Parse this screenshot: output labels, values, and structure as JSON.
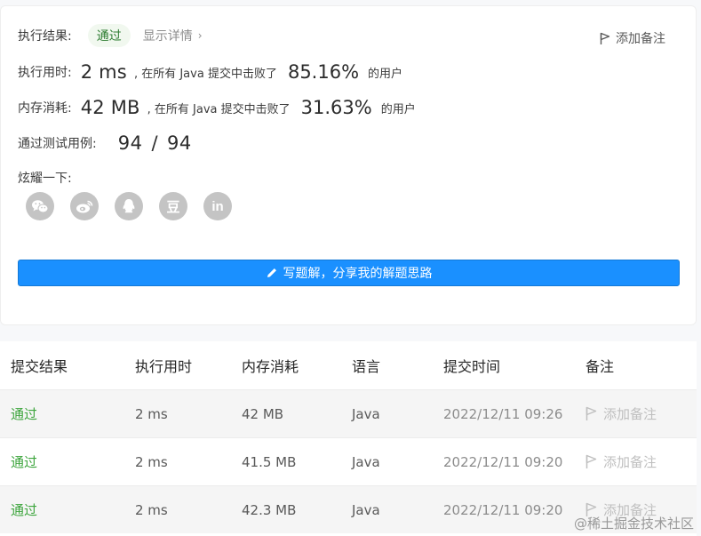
{
  "result": {
    "label": "执行结果:",
    "status": "通过",
    "detail_link": "显示详情",
    "add_note": "添加备注"
  },
  "runtime": {
    "label": "执行用时:",
    "value": "2 ms",
    "mid_text": ", 在所有 Java 提交中击败了",
    "percent": "85.16%",
    "suffix": "的用户"
  },
  "memory": {
    "label": "内存消耗:",
    "value": "42 MB",
    "mid_text": ", 在所有 Java 提交中击败了",
    "percent": "31.63%",
    "suffix": "的用户"
  },
  "testcases": {
    "label": "通过测试用例:",
    "passed": "94",
    "sep": "/",
    "total": "94"
  },
  "share": {
    "label": "炫耀一下:",
    "icons": [
      "wechat-icon",
      "weibo-icon",
      "qq-icon",
      "douban-icon",
      "linkedin-icon"
    ],
    "douban_text": "豆",
    "linkedin_text": "in"
  },
  "write_solution_label": "写题解，分享我的解题思路",
  "table": {
    "headers": [
      "提交结果",
      "执行用时",
      "内存消耗",
      "语言",
      "提交时间",
      "备注"
    ],
    "rows": [
      {
        "result": "通过",
        "time": "2 ms",
        "memory": "42 MB",
        "lang": "Java",
        "submitted": "2022/12/11 09:26",
        "note": "添加备注"
      },
      {
        "result": "通过",
        "time": "2 ms",
        "memory": "41.5 MB",
        "lang": "Java",
        "submitted": "2022/12/11 09:20",
        "note": "添加备注"
      },
      {
        "result": "通过",
        "time": "2 ms",
        "memory": "42.3 MB",
        "lang": "Java",
        "submitted": "2022/12/11 09:20",
        "note": "添加备注"
      }
    ]
  },
  "watermark": "@稀土掘金技术社区",
  "colors": {
    "accent": "#1a90ff",
    "pass_green": "#3da53d",
    "icon_gray": "#c4c4c4"
  }
}
